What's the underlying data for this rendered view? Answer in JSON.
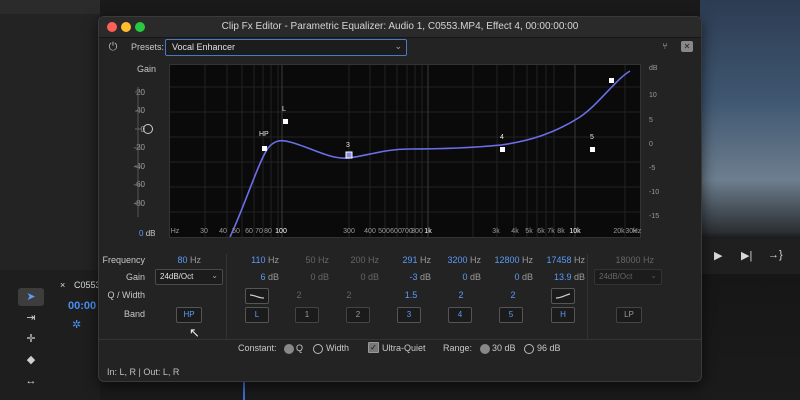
{
  "window": {
    "title": "Clip Fx Editor - Parametric Equalizer: Audio 1, C0553.MP4, Effect 4, 00:00:00:00"
  },
  "traffic": {
    "close": "#ff5f57",
    "minimize": "#febc2e",
    "zoom": "#28c840"
  },
  "presets": {
    "label": "Presets:",
    "value": "Vocal Enhancer"
  },
  "graph": {
    "gain_label": "Gain",
    "left_ticks": [
      "20",
      "40",
      "20",
      "0",
      "-20",
      "-40",
      "-60",
      "-80"
    ],
    "db_label_value": "0",
    "db_label_unit": "dB",
    "right_ticks": [
      "dB",
      "10",
      "5",
      "0",
      "-5",
      "-10",
      "-15"
    ],
    "x_ticks": [
      "Hz",
      "20",
      "30",
      "40",
      "50",
      "60",
      "70",
      "80",
      "100",
      "200",
      "300",
      "400",
      "500",
      "600",
      "700",
      "800",
      "1k",
      "2k",
      "3k",
      "4k",
      "5k",
      "6k",
      "7k",
      "8k",
      "10k",
      "20k",
      "30k",
      "Hz"
    ],
    "curve_color": "#6b6ee8",
    "points": [
      {
        "label": "HP"
      },
      {
        "label": "L"
      },
      {
        "label": "3"
      },
      {
        "label": "4"
      },
      {
        "label": "5"
      },
      {
        "label": ""
      }
    ]
  },
  "rows": {
    "frequency": "Frequency",
    "gain": "Gain",
    "q_width": "Q / Width",
    "band": "Band"
  },
  "hp": {
    "freq": "80",
    "unit": "Hz",
    "slope": "24dB/Oct",
    "band": "HP"
  },
  "bands": [
    {
      "freq": "110",
      "gain": "6",
      "q": "",
      "band": "L",
      "active": true
    },
    {
      "freq": "50",
      "gain": "0",
      "q": "2",
      "band": "1",
      "active": false
    },
    {
      "freq": "200",
      "gain": "0",
      "q": "2",
      "band": "2",
      "active": false
    },
    {
      "freq": "291",
      "gain": "-3",
      "q": "1.5",
      "band": "3",
      "active": true
    },
    {
      "freq": "3200",
      "gain": "0",
      "q": "2",
      "band": "4",
      "active": true
    },
    {
      "freq": "12800",
      "gain": "0",
      "q": "2",
      "band": "5",
      "active": true
    },
    {
      "freq": "17458",
      "gain": "13.9",
      "q": "",
      "band": "H",
      "active": true
    }
  ],
  "units": {
    "hz": "Hz",
    "db": "dB"
  },
  "lp": {
    "freq": "18000",
    "unit": "Hz",
    "slope": "24dB/Oct",
    "band": "LP"
  },
  "options": {
    "constant": "Constant:",
    "q": "Q",
    "width": "Width",
    "ultra_quiet": "Ultra-Quiet",
    "range": "Range:",
    "r30": "30 dB",
    "r96": "96 dB"
  },
  "status": "In: L, R | Out: L, R",
  "background": {
    "clip_tab": "C0553",
    "timecode": "00:00",
    "transport": [
      "▶",
      "▶|",
      "→}"
    ]
  }
}
